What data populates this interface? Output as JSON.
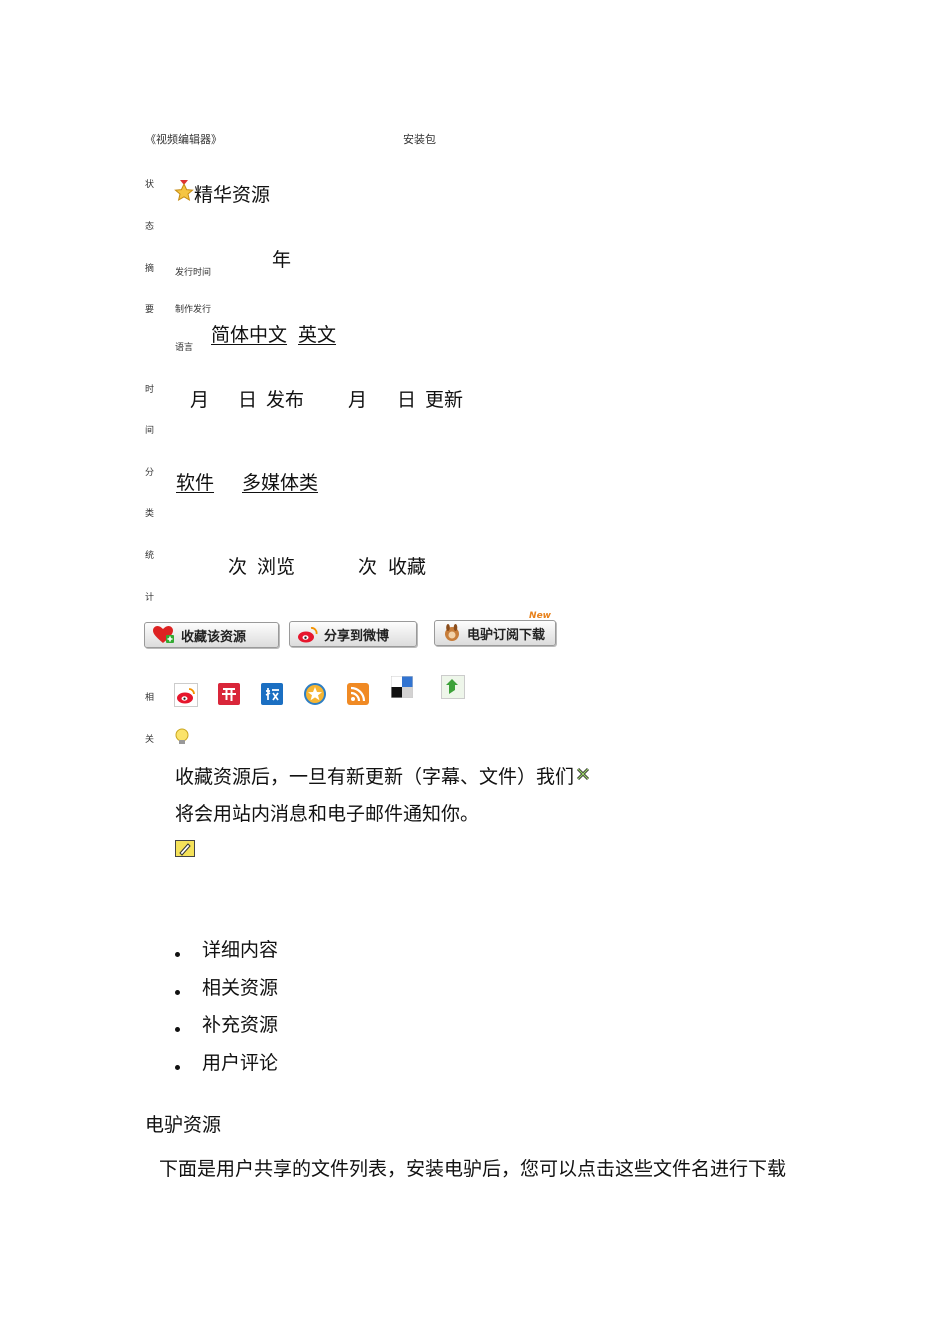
{
  "header": {
    "title": "《视频编辑器》",
    "package": "安装包"
  },
  "side_labels": [
    "状",
    "态",
    "摘",
    "要",
    "时",
    "间",
    "分",
    "类",
    "统",
    "计",
    "相",
    "关"
  ],
  "status": {
    "label": "精华资源",
    "icon": "star-medal-icon"
  },
  "summary": {
    "release_time_label": "发行时间",
    "year": "年",
    "producer_label": "制作发行",
    "language_label": "语言",
    "languages": [
      "简体中文",
      "英文"
    ]
  },
  "time": {
    "month1": "月",
    "day1": "日",
    "publish": "发布",
    "month2": "月",
    "day2": "日",
    "update": "更新"
  },
  "category": {
    "items": [
      "软件",
      "多媒体类"
    ]
  },
  "stats": {
    "times1": "次",
    "views": "浏览",
    "times2": "次",
    "favorites": "收藏"
  },
  "buttons": {
    "favorite": "收藏该资源",
    "share_weibo": "分享到微博",
    "subscribe": "电驴订阅下载",
    "new_badge": "New"
  },
  "share_icons": [
    "weibo-icon",
    "kaixin-icon",
    "xiaonei-icon",
    "qzone-icon",
    "rss-icon",
    "delicious-icon",
    "other-share-icon"
  ],
  "notice": {
    "line1": "收藏资源后，一旦有新更新（字幕、文件）我们",
    "line2": "将会用站内消息和电子邮件通知你。"
  },
  "tabs": [
    "详细内容",
    "相关资源",
    "补充资源",
    "用户评论"
  ],
  "section": {
    "title": "电驴资源",
    "description": "下面是用户共享的文件列表，安装电驴后，您可以点击这些文件名进行下载"
  },
  "colors": {
    "text": "#111111",
    "accent_orange": "#e8811a",
    "button_border": "#9a9a9a"
  }
}
